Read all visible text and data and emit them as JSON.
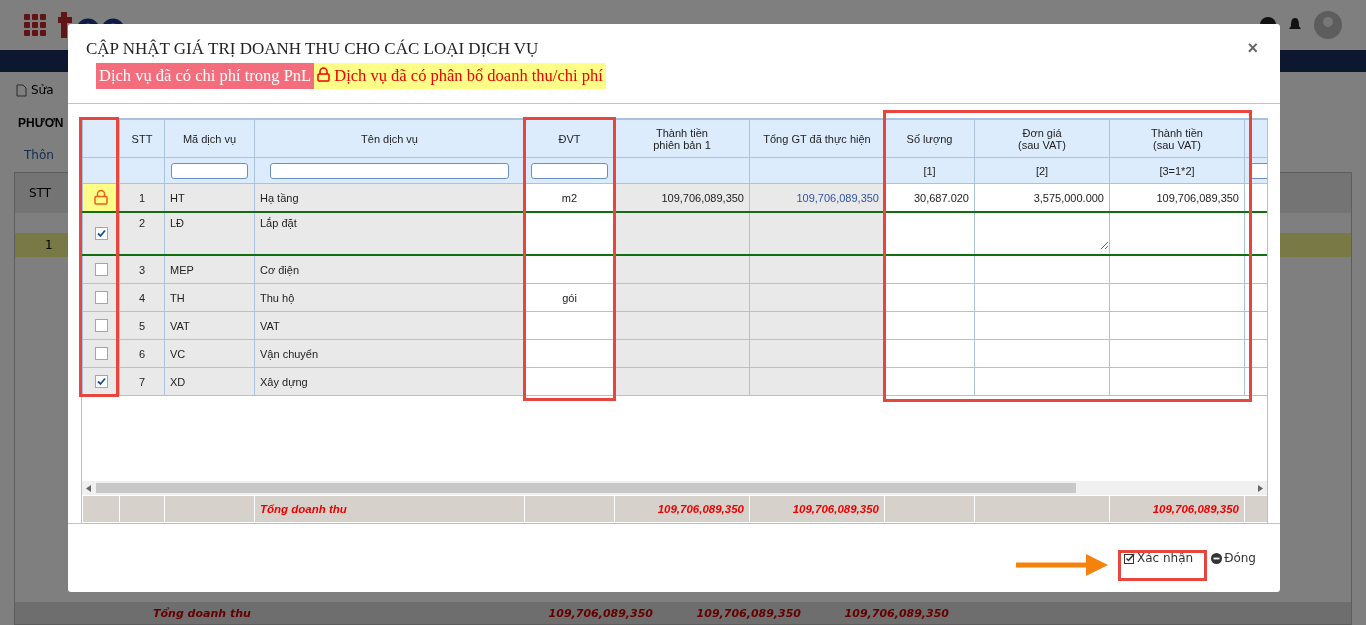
{
  "background": {
    "toolbar": [
      {
        "label": "Sửa"
      }
    ],
    "section_title": "PHƯƠN",
    "tab": "Thôn",
    "table_header": "STT",
    "row_number": "1",
    "total_label": "Tổng doanh thu",
    "totals": [
      "109,706,089,350",
      "109,706,089,350",
      "109,706,089,350"
    ]
  },
  "dialog": {
    "title": "CẬP NHẬT GIÁ TRỊ DOANH THU CHO CÁC LOẠI DỊCH VỤ",
    "close_symbol": "×",
    "legend": [
      {
        "label": "Dịch vụ đã có chi phí trong PnL",
        "kind": "cost"
      },
      {
        "label": "Dịch vụ đã có phân bổ doanh thu/chi phí",
        "kind": "allocated"
      }
    ],
    "table": {
      "columns": [
        {
          "label": "STT",
          "kind": "index"
        },
        {
          "label": "Mã dịch vụ",
          "kind": "text",
          "filter": true
        },
        {
          "label": "Tên dịch vụ",
          "kind": "text",
          "filter": true,
          "total": "Tổng doanh thu"
        },
        {
          "label": "ĐVT",
          "kind": "unit",
          "filter": true,
          "editable": true
        },
        {
          "label": "Thành tiền\nphiên bản 1",
          "kind": "number",
          "total": "109,706,089,350"
        },
        {
          "label": "Tổng GT đã thực hiện",
          "kind": "link",
          "total": "109,706,089,350"
        },
        {
          "label": "Số lượng",
          "formula": "[1]",
          "kind": "number",
          "editable": true
        },
        {
          "label": "Đơn giá\n(sau VAT)",
          "formula": "[2]",
          "kind": "price",
          "editable": true
        },
        {
          "label": "Thành tiền\n(sau VAT)",
          "formula": "[3=1*2]",
          "kind": "number",
          "editable": true,
          "total": "109,706,089,350"
        },
        {
          "kind": "text",
          "filter": true,
          "editable": true
        }
      ],
      "rows": [
        {
          "kind": "locked",
          "selected": false,
          "cells": [
            "1",
            "HT",
            "Hạ tầng",
            "m2",
            "109,706,089,350",
            "109,706,089,350",
            "30,687.020",
            "3,575,000.000",
            "109,706,089,350",
            null
          ]
        },
        {
          "kind": "checkbox",
          "checked": true,
          "selected": true,
          "cells": [
            "2",
            "LĐ",
            "Lắp đặt",
            null,
            null,
            null,
            null,
            null,
            null,
            null
          ]
        },
        {
          "kind": "checkbox",
          "checked": false,
          "selected": false,
          "cells": [
            "3",
            "MEP",
            "Cơ điện",
            null,
            null,
            null,
            null,
            null,
            null,
            null
          ]
        },
        {
          "kind": "checkbox",
          "checked": false,
          "selected": false,
          "cells": [
            "4",
            "TH",
            "Thu hộ",
            "gói",
            null,
            null,
            null,
            null,
            null,
            null
          ]
        },
        {
          "kind": "checkbox",
          "checked": false,
          "selected": false,
          "cells": [
            "5",
            "VAT",
            "VAT",
            null,
            null,
            null,
            null,
            null,
            null,
            null
          ]
        },
        {
          "kind": "checkbox",
          "checked": false,
          "selected": false,
          "cells": [
            "6",
            "VC",
            "Vận chuyển",
            null,
            null,
            null,
            null,
            null,
            null,
            null
          ]
        },
        {
          "kind": "checkbox",
          "checked": true,
          "selected": false,
          "cells": [
            "7",
            "XD",
            "Xây dựng",
            null,
            null,
            null,
            null,
            null,
            null,
            null
          ]
        }
      ]
    },
    "buttons": [
      {
        "label": "Xác nhận",
        "kind": "confirm"
      },
      {
        "label": "Đóng",
        "kind": "close"
      }
    ]
  }
}
